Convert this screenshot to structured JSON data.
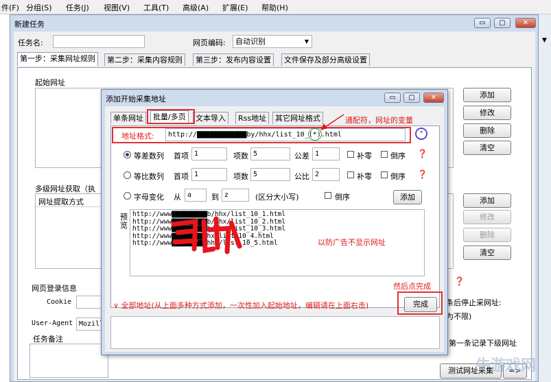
{
  "menubar": [
    "件(F)",
    "分组(S)",
    "任务(J)",
    "视图(V)",
    "工具(T)",
    "高级(A)",
    "扩展(E)",
    "帮助(H)"
  ],
  "main_window": {
    "title": "新建任务",
    "task_name_label": "任务名:",
    "encoding_label": "网页编码:",
    "encoding_value": "自动识别",
    "tabs": [
      "第一步：采集网址规则",
      "第二步：采集内容规则",
      "第三步：发布内容设置",
      "文件保存及部分高级设置"
    ],
    "start_url_label": "起始网址",
    "buttons_top": [
      "添加",
      "修改",
      "删除",
      "清空"
    ],
    "multi_level_label": "多级网址获取（执",
    "url_extract_col": "网址提取方式",
    "buttons_mid": [
      "添加",
      "修改",
      "删除",
      "清空"
    ],
    "login_label": "网页登录信息",
    "cookie_label": "Cookie",
    "ua_label": "User-Agent",
    "ua_value": "Mozill",
    "stop_text_1": "条后停止采网址:",
    "stop_text_2": "为不限)",
    "first_record_text": "第一条记录下级网址",
    "remark_label": "任务备注",
    "test_button": "测试网址采集"
  },
  "dialog": {
    "title": "添加开始采集地址",
    "tabs": [
      "单条网址",
      "批量/多页",
      "文本导入",
      "Rss地址",
      "其它网址格式"
    ],
    "address_format_label": "地址格式:",
    "address_value": "http://▇▇▇▇▇▇▇▇▇▇▇▇by/hhx/list_10_(*).html",
    "wildcard_annotation": "通配符，网址的变量",
    "arith": {
      "label": "等差数列",
      "first_label": "首项",
      "first": "1",
      "count_label": "项数",
      "count": "5",
      "diff_label": "公差",
      "diff": "1",
      "pad": "补零",
      "reverse": "倒序"
    },
    "geom": {
      "label": "等比数列",
      "first_label": "首项",
      "first": "1",
      "count_label": "项数",
      "count": "5",
      "ratio_label": "公比",
      "ratio": "2",
      "pad": "补零",
      "reverse": "倒序"
    },
    "letter": {
      "label": "字母变化",
      "from_label": "从",
      "from": "a",
      "to_label": "到",
      "to": "z",
      "case_note": "(区分大小写)",
      "reverse": "倒序",
      "add": "添加"
    },
    "preview_label_1": "预",
    "preview_label_2": "览",
    "preview_lines": [
      "http://www▇▇▇▇▇▇▇▇▇b/hhx/list_10_1.html",
      "http://www▇▇▇▇▇▇▇▇▇b/hhx/list_10_2.html",
      "http://www▇▇▇▇▇▇▇▇▇b/hhx/list_10_3.html",
      "http://www▇▇▇▇▇▇▇▇▇hx/list_10_4.html",
      "http://www▇▇▇▇▇▇▇▇▇hhx/list_10_5.html"
    ],
    "hide_url_annotation": "以防广告不显示网址",
    "then_done_annotation": "然后点完成",
    "all_address_text": "∨ 全部地址(从上面多种方式添加，一次性加入起始地址，编辑请在上面右击)",
    "done_button": "完成"
  },
  "watermark": "牛游戏网",
  "colors": {
    "annotation_red": "#e01a1a",
    "scribble_red": "#e8141b",
    "window_blue": "#cfdcee",
    "highlight_box": "#e03030"
  }
}
